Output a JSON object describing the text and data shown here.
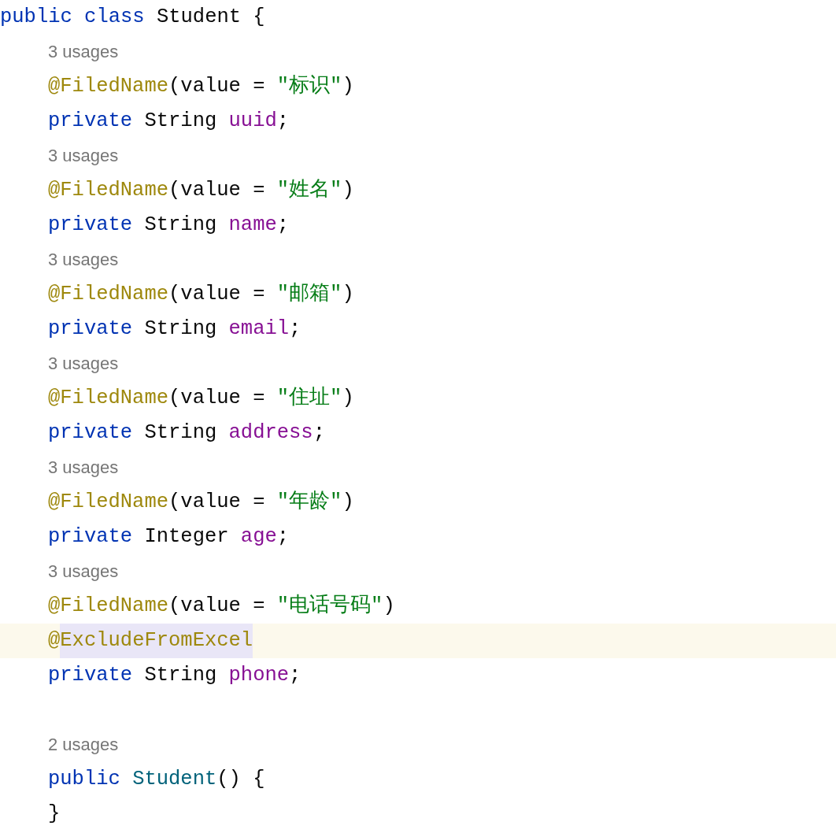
{
  "lines": [
    {
      "kind": "code",
      "tokens": [
        {
          "kind": "keyword",
          "text": "public class "
        },
        {
          "kind": "plain",
          "text": "Student {"
        }
      ]
    },
    {
      "kind": "usages",
      "text": "3 usages"
    },
    {
      "kind": "code",
      "indent": true,
      "tokens": [
        {
          "kind": "annotation",
          "text": "@FiledName"
        },
        {
          "kind": "plain",
          "text": "(value = "
        },
        {
          "kind": "string",
          "text": "\"标识\""
        },
        {
          "kind": "plain",
          "text": ")"
        }
      ]
    },
    {
      "kind": "code",
      "indent": true,
      "tokens": [
        {
          "kind": "keyword",
          "text": "private "
        },
        {
          "kind": "plain",
          "text": "String "
        },
        {
          "kind": "field",
          "text": "uuid"
        },
        {
          "kind": "plain",
          "text": ";"
        }
      ]
    },
    {
      "kind": "usages",
      "text": "3 usages"
    },
    {
      "kind": "code",
      "indent": true,
      "tokens": [
        {
          "kind": "annotation",
          "text": "@FiledName"
        },
        {
          "kind": "plain",
          "text": "(value = "
        },
        {
          "kind": "string",
          "text": "\"姓名\""
        },
        {
          "kind": "plain",
          "text": ")"
        }
      ]
    },
    {
      "kind": "code",
      "indent": true,
      "tokens": [
        {
          "kind": "keyword",
          "text": "private "
        },
        {
          "kind": "plain",
          "text": "String "
        },
        {
          "kind": "field",
          "text": "name"
        },
        {
          "kind": "plain",
          "text": ";"
        }
      ]
    },
    {
      "kind": "usages",
      "text": "3 usages"
    },
    {
      "kind": "code",
      "indent": true,
      "tokens": [
        {
          "kind": "annotation",
          "text": "@FiledName"
        },
        {
          "kind": "plain",
          "text": "(value = "
        },
        {
          "kind": "string",
          "text": "\"邮箱\""
        },
        {
          "kind": "plain",
          "text": ")"
        }
      ]
    },
    {
      "kind": "code",
      "indent": true,
      "tokens": [
        {
          "kind": "keyword",
          "text": "private "
        },
        {
          "kind": "plain",
          "text": "String "
        },
        {
          "kind": "field",
          "text": "email"
        },
        {
          "kind": "plain",
          "text": ";"
        }
      ]
    },
    {
      "kind": "usages",
      "text": "3 usages"
    },
    {
      "kind": "code",
      "indent": true,
      "tokens": [
        {
          "kind": "annotation",
          "text": "@FiledName"
        },
        {
          "kind": "plain",
          "text": "(value = "
        },
        {
          "kind": "string",
          "text": "\"住址\""
        },
        {
          "kind": "plain",
          "text": ")"
        }
      ]
    },
    {
      "kind": "code",
      "indent": true,
      "tokens": [
        {
          "kind": "keyword",
          "text": "private "
        },
        {
          "kind": "plain",
          "text": "String "
        },
        {
          "kind": "field",
          "text": "address"
        },
        {
          "kind": "plain",
          "text": ";"
        }
      ]
    },
    {
      "kind": "usages",
      "text": "3 usages"
    },
    {
      "kind": "code",
      "indent": true,
      "tokens": [
        {
          "kind": "annotation",
          "text": "@FiledName"
        },
        {
          "kind": "plain",
          "text": "(value = "
        },
        {
          "kind": "string",
          "text": "\"年龄\""
        },
        {
          "kind": "plain",
          "text": ")"
        }
      ]
    },
    {
      "kind": "code",
      "indent": true,
      "tokens": [
        {
          "kind": "keyword",
          "text": "private "
        },
        {
          "kind": "plain",
          "text": "Integer "
        },
        {
          "kind": "field",
          "text": "age"
        },
        {
          "kind": "plain",
          "text": ";"
        }
      ]
    },
    {
      "kind": "usages",
      "text": "3 usages"
    },
    {
      "kind": "code",
      "indent": true,
      "tokens": [
        {
          "kind": "annotation",
          "text": "@FiledName"
        },
        {
          "kind": "plain",
          "text": "(value = "
        },
        {
          "kind": "string",
          "text": "\"电话号码\""
        },
        {
          "kind": "plain",
          "text": ")"
        }
      ]
    },
    {
      "kind": "code",
      "indent": true,
      "current": true,
      "tokens": [
        {
          "kind": "annotation",
          "text": "@"
        },
        {
          "kind": "annotation",
          "text": "ExcludeFromExcel",
          "highlighted": true
        }
      ]
    },
    {
      "kind": "code",
      "indent": true,
      "tokens": [
        {
          "kind": "keyword",
          "text": "private "
        },
        {
          "kind": "plain",
          "text": "String "
        },
        {
          "kind": "field",
          "text": "phone"
        },
        {
          "kind": "plain",
          "text": ";"
        }
      ]
    },
    {
      "kind": "blank"
    },
    {
      "kind": "usages",
      "text": "2 usages"
    },
    {
      "kind": "code",
      "indent": true,
      "tokens": [
        {
          "kind": "keyword",
          "text": "public "
        },
        {
          "kind": "method",
          "text": "Student"
        },
        {
          "kind": "plain",
          "text": "() {"
        }
      ]
    },
    {
      "kind": "code",
      "indent": true,
      "tokens": [
        {
          "kind": "plain",
          "text": "}"
        }
      ]
    }
  ]
}
